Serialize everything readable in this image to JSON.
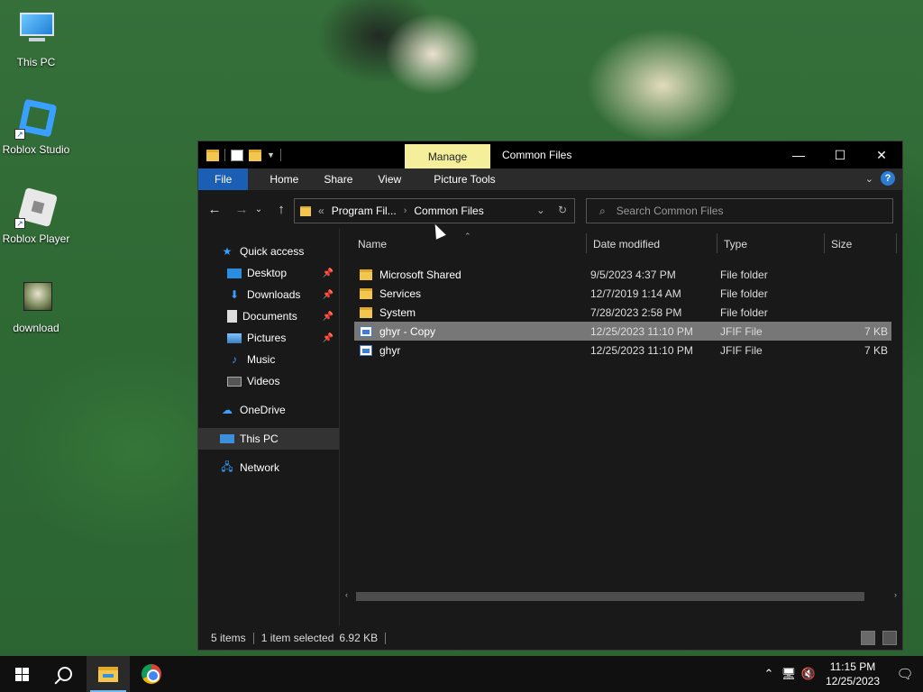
{
  "desktop": {
    "icons": [
      {
        "label": "This PC"
      },
      {
        "label": "Roblox Studio"
      },
      {
        "label": "Roblox Player"
      },
      {
        "label": "download"
      }
    ]
  },
  "window": {
    "title": "Common Files",
    "manage_tab": "Manage",
    "controls": {
      "minimize": "—",
      "maximize": "☐",
      "close": "✕"
    },
    "ribbon": {
      "tabs": [
        "File",
        "Home",
        "Share",
        "View",
        "Picture Tools"
      ]
    },
    "address": {
      "overflow": "«",
      "crumbs": [
        "Program Fil...",
        "Common Files"
      ]
    },
    "search": {
      "placeholder": "Search Common Files"
    },
    "nav_pane": {
      "items": [
        {
          "label": "Quick access"
        },
        {
          "label": "Desktop"
        },
        {
          "label": "Downloads"
        },
        {
          "label": "Documents"
        },
        {
          "label": "Pictures"
        },
        {
          "label": "Music"
        },
        {
          "label": "Videos"
        },
        {
          "label": "OneDrive"
        },
        {
          "label": "This PC"
        },
        {
          "label": "Network"
        }
      ]
    },
    "columns": [
      "Name",
      "Date modified",
      "Type",
      "Size"
    ],
    "files": [
      {
        "name": "Microsoft Shared",
        "date": "9/5/2023 4:37 PM",
        "type": "File folder",
        "size": "",
        "icon": "folder-icon"
      },
      {
        "name": "Services",
        "date": "12/7/2019 1:14 AM",
        "type": "File folder",
        "size": "",
        "icon": "folder-icon"
      },
      {
        "name": "System",
        "date": "7/28/2023 2:58 PM",
        "type": "File folder",
        "size": "",
        "icon": "folder-icon"
      },
      {
        "name": "ghyr - Copy",
        "date": "12/25/2023 11:10 PM",
        "type": "JFIF File",
        "size": "7 KB",
        "icon": "jfif-file-icon"
      },
      {
        "name": "ghyr",
        "date": "12/25/2023 11:10 PM",
        "type": "JFIF File",
        "size": "7 KB",
        "icon": "jfif-file-icon"
      }
    ],
    "status": {
      "count": "5 items",
      "selection": "1 item selected",
      "size": "6.92 KB"
    }
  },
  "taskbar": {
    "clock_time": "11:15 PM",
    "clock_date": "12/25/2023"
  },
  "colors": {
    "file_tab": "#1a5fb4",
    "manage_tab": "#f5ef9c",
    "folder": "#f3c74f",
    "selected_row": "#777777"
  }
}
